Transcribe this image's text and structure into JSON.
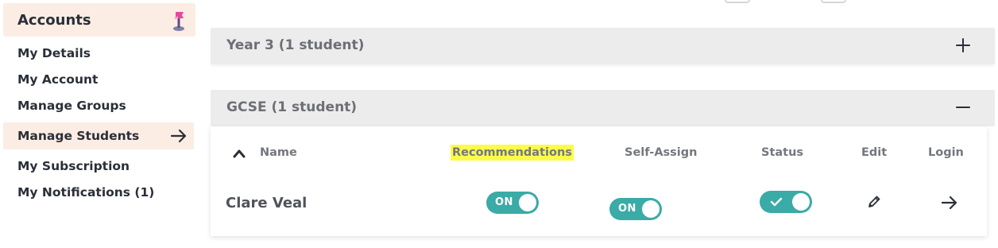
{
  "sidebar": {
    "title": "Accounts",
    "logo_icon": "flag-logo-icon",
    "items": [
      {
        "label": "My Details"
      },
      {
        "label": "My Account"
      },
      {
        "label": "Manage Groups"
      },
      {
        "label": "Manage Students",
        "active": true,
        "icon": "arrow-right-icon"
      },
      {
        "label": "My Subscription"
      },
      {
        "label": "My Notifications (1)"
      }
    ]
  },
  "groups": [
    {
      "title": "Year 3 (1 student)",
      "expanded": false,
      "toggle_icon": "plus-icon"
    },
    {
      "title": "GCSE (1 student)",
      "expanded": true,
      "toggle_icon": "minus-icon",
      "columns": {
        "name": "Name",
        "recommendations": "Recommendations",
        "self_assign": "Self-Assign",
        "status": "Status",
        "edit": "Edit",
        "login": "Login"
      },
      "sort_icon": "chevron-up-icon",
      "students": [
        {
          "name": "Clare Veal",
          "recommendations": "ON",
          "self_assign": "ON",
          "status": "active",
          "status_icon": "check-icon",
          "edit_icon": "pencil-icon",
          "login_icon": "arrow-right-icon"
        }
      ]
    }
  ],
  "colors": {
    "accent_teal": "#3aaba6",
    "sidebar_highlight": "#fbede3",
    "header_highlight": "#fbfb4a",
    "group_bar": "#ececec"
  }
}
